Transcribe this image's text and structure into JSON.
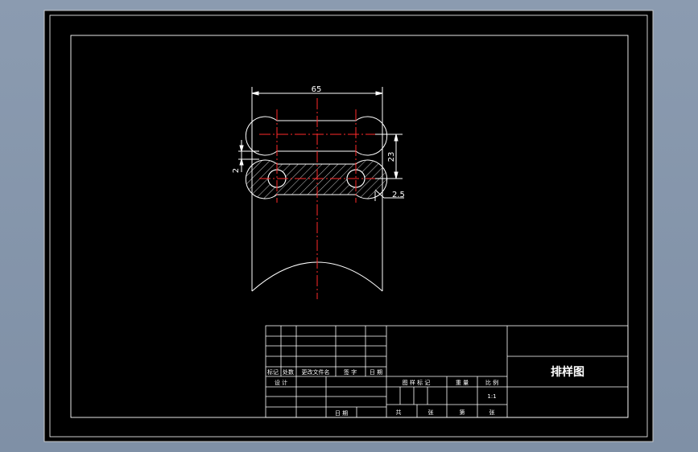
{
  "colors": {
    "background": "#8b9bb0",
    "sheet": "#000000",
    "line": "#ffffff",
    "centerline": "#ff2a2a"
  },
  "dimensions": {
    "width": "65",
    "pitch": "23",
    "gap": "2",
    "margin": "2.5"
  },
  "title_block": {
    "title": "排样图",
    "rev_headers": {
      "mark": "标记",
      "count": "处数",
      "change_doc": "更改文件名",
      "sign": "签 字",
      "date": "日 期"
    },
    "designer_label": "设 计",
    "date_label": "日 期",
    "stage_mark": "图 样 标 记",
    "weight": "重 量",
    "scale_label": "比 例",
    "scale_value": "1:1",
    "total": "共",
    "sheet_unit1": "张",
    "sheet_label": "第",
    "sheet_unit2": "张"
  }
}
